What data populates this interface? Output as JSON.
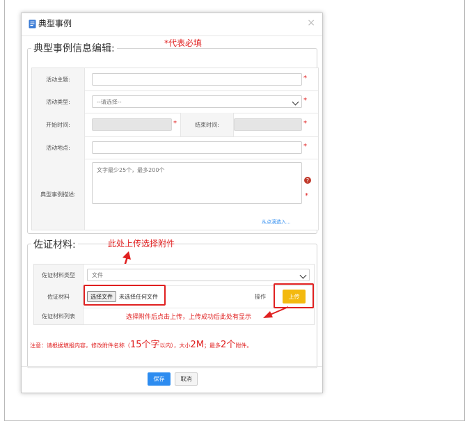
{
  "dialog": {
    "title": "典型事例",
    "close_icon": "×",
    "required_note": "*代表必填"
  },
  "info_section": {
    "legend": "典型事例信息编辑:",
    "fields": {
      "theme_label": "活动主题:",
      "type_label": "活动类型:",
      "type_value": "--请选择--",
      "start_label": "开始时间:",
      "end_label": "结束时间:",
      "location_label": "活动地点:",
      "desc_label": "典型事例描述:",
      "desc_placeholder": "文字最少25个，最多200个",
      "desc_link": "从点滴选入..."
    },
    "required_mark": "*",
    "help_icon": "?"
  },
  "evidence_section": {
    "legend": "佐证材料:",
    "material_type_label": "佐证材料类型",
    "material_type_value": "文件",
    "material_label": "佐证材料",
    "choose_file_button": "选择文件",
    "no_file_text": "未选择任何文件",
    "operation_label": "操作",
    "upload_button": "上传",
    "material_list_label": "佐证材料列表"
  },
  "annotations": {
    "upload_here": "此处上传选择附件",
    "after_upload": "选择附件后点击上传，上传成功后此处有显示"
  },
  "notice": {
    "part1": "注意：请根据填报内容，修改附件名称（",
    "big1": "15个字",
    "small1": "以内",
    "part2": "），大小",
    "big2": "2M",
    "part3": "；最多",
    "big3": "2个",
    "part4": "附件。"
  },
  "footer": {
    "save_button": "保存",
    "cancel_button": "取消"
  },
  "colors": {
    "annotation_red": "#e02020",
    "save_blue": "#2d8cf0",
    "upload_yellow": "#f3b90f"
  }
}
